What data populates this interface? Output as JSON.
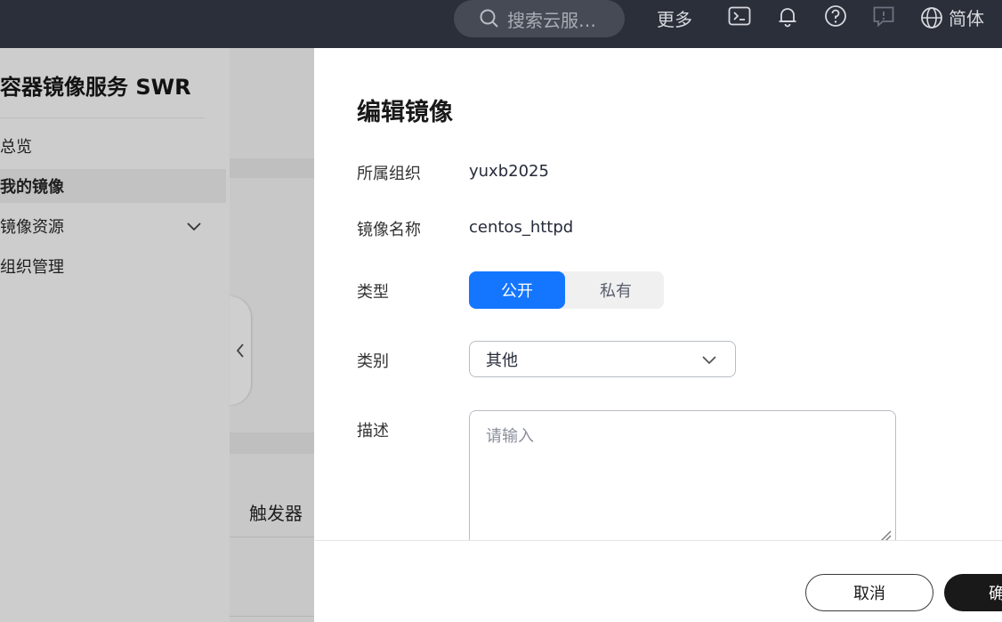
{
  "header": {
    "search_placeholder": "搜索云服…",
    "more_label": "更多",
    "lang_label": "简体"
  },
  "sidebar": {
    "title": "容器镜像服务 SWR",
    "items": [
      {
        "label": "总览"
      },
      {
        "label": "我的镜像"
      },
      {
        "label": "镜像资源"
      },
      {
        "label": "组织管理"
      }
    ]
  },
  "background": {
    "trigger_label": "触发器"
  },
  "dialog": {
    "title": "编辑镜像",
    "org_label": "所属组织",
    "org_value": "yuxb2025",
    "name_label": "镜像名称",
    "name_value": "centos_httpd",
    "type_label": "类型",
    "type_options": [
      "公开",
      "私有"
    ],
    "type_selected": "公开",
    "category_label": "类别",
    "category_value": "其他",
    "desc_label": "描述",
    "desc_placeholder": "请输入",
    "cancel_label": "取消",
    "ok_label": "确"
  },
  "colors": {
    "topbar": "#2b2f3a",
    "primary": "#1476ff",
    "ok_button": "#191919"
  }
}
